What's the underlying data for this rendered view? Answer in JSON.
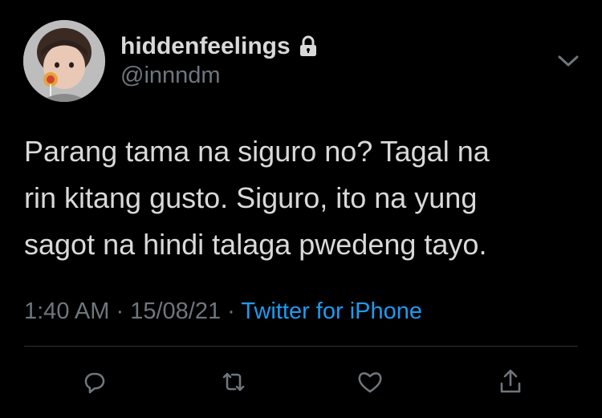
{
  "tweet": {
    "display_name": "hiddenfeelings",
    "handle": "@innndm",
    "text_lines": [
      "Parang tama na siguro no? Tagal na",
      "rin kitang gusto. Siguro, ito na yung",
      "sagot na hindi talaga pwedeng tayo."
    ],
    "time": "1:40 AM",
    "separator": "·",
    "date": "15/08/21",
    "source": "Twitter for iPhone"
  },
  "icons": {
    "lock": "lock-icon",
    "chevron": "chevron-down-icon",
    "reply": "reply-icon",
    "retweet": "retweet-icon",
    "like": "heart-icon",
    "share": "share-icon"
  },
  "colors": {
    "background": "#000000",
    "text": "#d9d9d9",
    "secondary": "#6e767d",
    "link": "#1d9bf0",
    "divider": "#2f3336"
  }
}
